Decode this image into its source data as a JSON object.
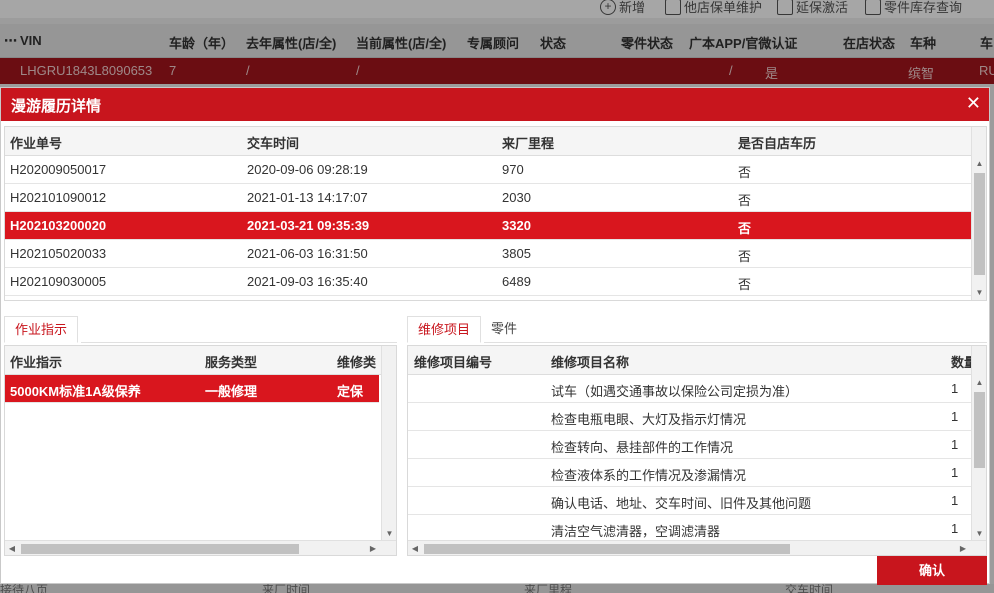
{
  "background": {
    "toolbar": [
      "新增",
      "他店保单维护",
      "延保激活",
      "零件库存查询"
    ],
    "headers": [
      "VIN",
      "车龄（年）",
      "去年属性(店/全)",
      "当前属性(店/全)",
      "专属顾问",
      "状态",
      "零件状态",
      "广本APP/官微认证",
      "在店状态",
      "车种",
      "车"
    ],
    "row": [
      "LHGRU1843L8090653",
      "7",
      "/",
      "/",
      "/",
      "是",
      "缤智",
      "RU"
    ],
    "bottom": [
      "接待八页",
      "来厂时间",
      "来厂里程",
      "交车时间"
    ]
  },
  "modal": {
    "title": "漫游履历详情",
    "close": "✕",
    "history": {
      "columns": [
        "作业单号",
        "交车时间",
        "来厂里程",
        "是否自店车历"
      ],
      "rows": [
        [
          "H202009050017",
          "2020-09-06 09:28:19",
          "970",
          "否"
        ],
        [
          "H202101090012",
          "2021-01-13 14:17:07",
          "2030",
          "否"
        ],
        [
          "H202103200020",
          "2021-03-21 09:35:39",
          "3320",
          "否"
        ],
        [
          "H202105020033",
          "2021-06-03 16:31:50",
          "3805",
          "否"
        ],
        [
          "H202109030005",
          "2021-09-03 16:35:40",
          "6489",
          "否"
        ]
      ],
      "selected_index": 2
    },
    "left_tabs": [
      "作业指示"
    ],
    "instructions": {
      "columns": [
        "作业指示",
        "服务类型",
        "维修类"
      ],
      "rows": [
        [
          "5000KM标准1A级保养",
          "一般修理",
          "定保"
        ]
      ]
    },
    "right_tabs": [
      "维修项目",
      "零件"
    ],
    "repair_items": {
      "columns": [
        "维修项目编号",
        "维修项目名称",
        "数量"
      ],
      "rows": [
        [
          "",
          "试车（如遇交通事故以保险公司定损为准）",
          "1"
        ],
        [
          "",
          "检查电瓶电眼、大灯及指示灯情况",
          "1"
        ],
        [
          "",
          "检查转向、悬挂部件的工作情况",
          "1"
        ],
        [
          "",
          "检查液体系的工作情况及渗漏情况",
          "1"
        ],
        [
          "",
          "确认电话、地址、交车时间、旧件及其他问题",
          "1"
        ],
        [
          "",
          "清洁空气滤清器，空调滤清器",
          "1"
        ]
      ]
    },
    "confirm_label": "确认"
  }
}
